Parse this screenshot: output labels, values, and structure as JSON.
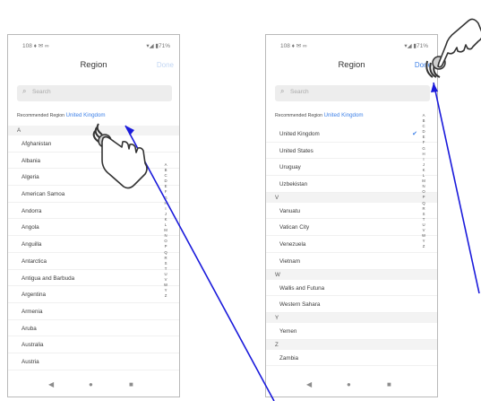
{
  "left": {
    "status": {
      "time": "108 ♦ ✉ ∞",
      "icons": "▾◢ ▮71%"
    },
    "nav": {
      "title": "Region",
      "done": "Done"
    },
    "search": {
      "placeholder": "Search"
    },
    "recommended": {
      "label": "Recommended Region",
      "value": "United Kingdom"
    },
    "rows": [
      {
        "text": "A",
        "header": true
      },
      {
        "text": "Afghanistan"
      },
      {
        "text": "Albania"
      },
      {
        "text": "Algeria"
      },
      {
        "text": "American Samoa"
      },
      {
        "text": "Andorra"
      },
      {
        "text": "Angola"
      },
      {
        "text": "Anguilla"
      },
      {
        "text": "Antarctica"
      },
      {
        "text": "Antigua and Barbuda"
      },
      {
        "text": "Argentina"
      },
      {
        "text": "Armenia"
      },
      {
        "text": "Aruba"
      },
      {
        "text": "Australia"
      },
      {
        "text": "Austria"
      }
    ],
    "index": [
      "A",
      "B",
      "C",
      "D",
      "E",
      "F",
      "G",
      "H",
      "I",
      "J",
      "K",
      "L",
      "M",
      "N",
      "O",
      "P",
      "Q",
      "R",
      "S",
      "T",
      "U",
      "V",
      "W",
      "Y",
      "Z"
    ]
  },
  "right": {
    "status": {
      "time": "108 ♦ ✉ ∞",
      "icons": "▾◢ ▮71%"
    },
    "nav": {
      "title": "Region",
      "done": "Done"
    },
    "search": {
      "placeholder": "Search"
    },
    "recommended": {
      "label": "Recommended Region",
      "value": "United Kingdom"
    },
    "rows": [
      {
        "text": "United Kingdom",
        "selected": true
      },
      {
        "text": "United States"
      },
      {
        "text": "Uruguay"
      },
      {
        "text": "Uzbekistan"
      },
      {
        "text": "V",
        "header": true
      },
      {
        "text": "Vanuatu"
      },
      {
        "text": "Vatican City"
      },
      {
        "text": "Venezuela"
      },
      {
        "text": "Vietnam"
      },
      {
        "text": "W",
        "header": true
      },
      {
        "text": "Wallis and Futuna"
      },
      {
        "text": "Western Sahara"
      },
      {
        "text": "Y",
        "header": true
      },
      {
        "text": "Yemen"
      },
      {
        "text": "Z",
        "header": true
      },
      {
        "text": "Zambia"
      }
    ],
    "index": [
      "A",
      "B",
      "C",
      "D",
      "E",
      "F",
      "G",
      "H",
      "I",
      "J",
      "K",
      "L",
      "M",
      "N",
      "O",
      "P",
      "Q",
      "R",
      "S",
      "T",
      "U",
      "V",
      "W",
      "Y",
      "Z"
    ]
  },
  "system_nav": {
    "back": "◀",
    "home": "●",
    "recent": "■"
  },
  "icons": {
    "search": "search-icon",
    "check": "check-icon",
    "pointer": "tap-hand-icon"
  },
  "colors": {
    "accent": "#3f82e8",
    "annotation_line": "#1a1adb",
    "done_disabled": "#c2d6f3"
  }
}
